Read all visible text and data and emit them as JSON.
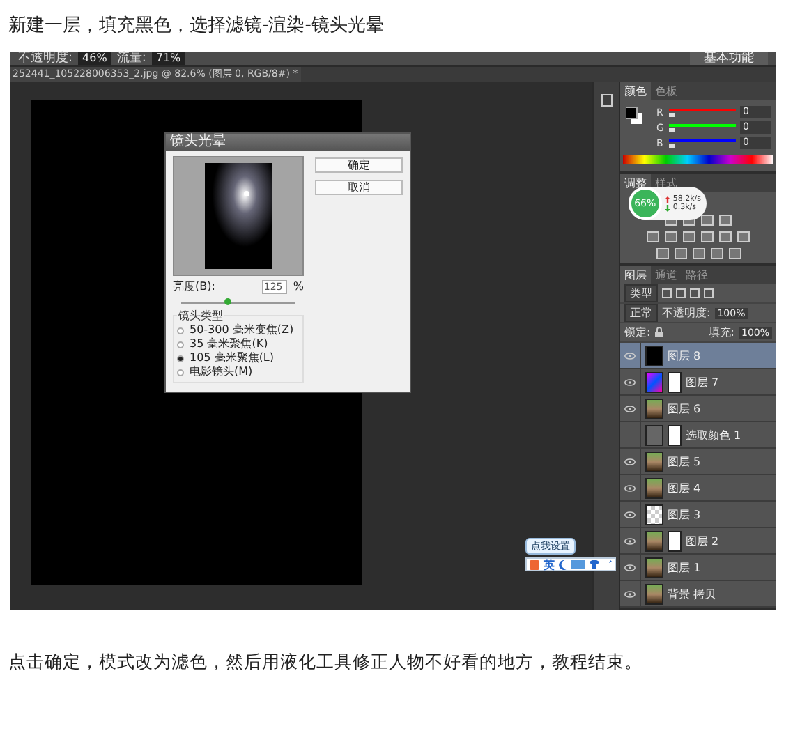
{
  "intro": "新建一层，填充黑色，选择滤镜-渲染-镜头光晕",
  "photoshop": {
    "options_bar": {
      "opacity_label": "不透明度:",
      "opacity": "46%",
      "flow_label": "流量:",
      "flow": "71%",
      "workspace": "基本功能"
    },
    "document_tab": "252441_105228006353_2.jpg @ 82.6% (图层 0, RGB/8#) *",
    "dialog": {
      "title": "镜头光晕",
      "ok": "确定",
      "cancel": "取消",
      "brightness_label": "亮度(B):",
      "brightness": "125",
      "unit": "%",
      "brightness_slider": {
        "level": 0.4
      },
      "lens_group": "镜头类型",
      "lens_types": [
        {
          "label": "50-300 毫米变焦(Z)",
          "selected": false
        },
        {
          "label": "35 毫米聚焦(K)",
          "selected": false
        },
        {
          "label": "105 毫米聚焦(L)",
          "selected": true
        },
        {
          "label": "电影镜头(M)",
          "selected": false
        }
      ]
    },
    "color_panel": {
      "tabs": [
        {
          "label": "颜色",
          "selected": true
        },
        {
          "label": "色板",
          "selected": false
        }
      ],
      "channels": [
        {
          "name": "R",
          "value": "0",
          "level": 0,
          "color": "#ff0000"
        },
        {
          "name": "G",
          "value": "0",
          "level": 0,
          "color": "#00ff00"
        },
        {
          "name": "B",
          "value": "0",
          "level": 0,
          "color": "#0000ff"
        }
      ]
    },
    "adjust_panel": {
      "tabs": [
        {
          "label": "调整",
          "selected": true
        },
        {
          "label": "样式",
          "selected": false
        }
      ]
    },
    "net_widget": {
      "percent": "66%",
      "up": "58.2k/s",
      "down": "0.3k/s"
    },
    "layers_panel": {
      "tabs": [
        {
          "label": "图层",
          "selected": true
        },
        {
          "label": "通道",
          "selected": false
        },
        {
          "label": "路径",
          "selected": false
        }
      ],
      "filter": "类型",
      "blend": "正常",
      "opacity_label": "不透明度:",
      "opacity": "100%",
      "lock_label": "锁定:",
      "fill_label": "填充:",
      "fill": "100%",
      "layers": [
        {
          "name": "图层 8",
          "kind": "black",
          "mask": false,
          "visible": true,
          "selected": true
        },
        {
          "name": "图层 7",
          "kind": "color",
          "mask": true,
          "visible": true,
          "selected": false
        },
        {
          "name": "图层 6",
          "kind": "photo",
          "mask": false,
          "visible": true,
          "selected": false
        },
        {
          "name": "选取颜色 1",
          "kind": "adjust",
          "mask": true,
          "visible": false,
          "selected": false
        },
        {
          "name": "图层 5",
          "kind": "photo",
          "mask": false,
          "visible": true,
          "selected": false
        },
        {
          "name": "图层 4",
          "kind": "photo",
          "mask": false,
          "visible": true,
          "selected": false
        },
        {
          "name": "图层 3",
          "kind": "empty",
          "mask": false,
          "visible": true,
          "selected": false
        },
        {
          "name": "图层 2",
          "kind": "photo",
          "mask": true,
          "visible": true,
          "selected": false
        },
        {
          "name": "图层 1",
          "kind": "photo",
          "mask": false,
          "visible": true,
          "selected": false
        },
        {
          "name": "背景 拷贝",
          "kind": "photo",
          "mask": false,
          "visible": true,
          "selected": false
        }
      ]
    },
    "ime": {
      "tooltip": "点我设置",
      "lang": "英"
    }
  },
  "outro": "点击确定，模式改为滤色，然后用液化工具修正人物不好看的地方，教程结束。"
}
